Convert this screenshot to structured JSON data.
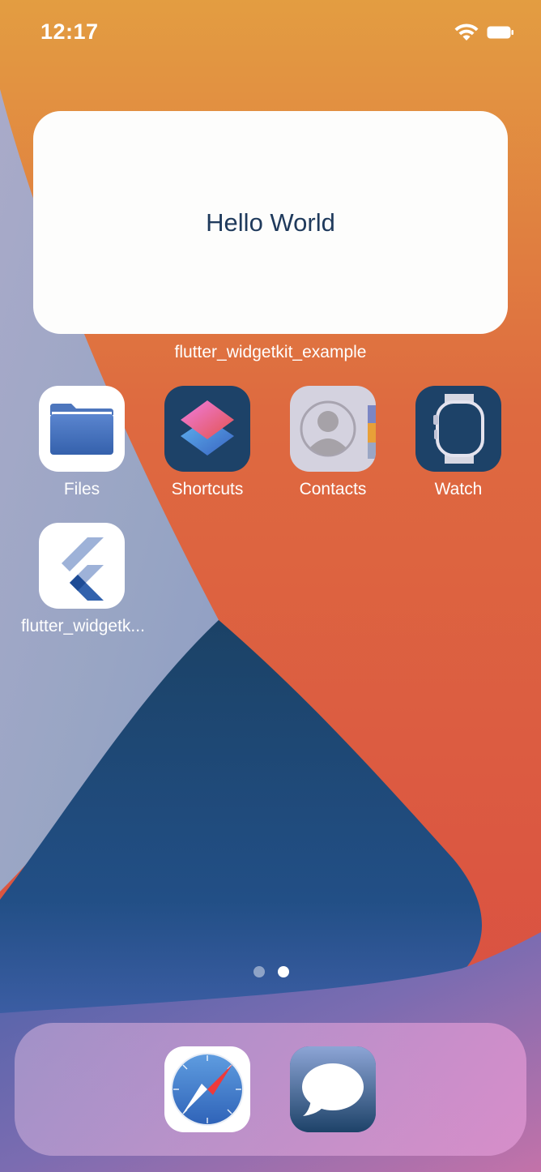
{
  "status_bar": {
    "time": "12:17",
    "wifi_icon": "wifi-icon",
    "battery_icon": "battery-icon"
  },
  "widget": {
    "text": "Hello World",
    "label": "flutter_widgetkit_example"
  },
  "apps": [
    {
      "label": "Files",
      "icon": "files-folder-icon"
    },
    {
      "label": "Shortcuts",
      "icon": "shortcuts-icon"
    },
    {
      "label": "Contacts",
      "icon": "contacts-icon"
    },
    {
      "label": "Watch",
      "icon": "watch-icon"
    },
    {
      "label": "flutter_widgetk...",
      "icon": "flutter-icon"
    }
  ],
  "page_indicator": {
    "pages": 2,
    "current": 2
  },
  "dock": [
    {
      "icon": "safari-compass-icon"
    },
    {
      "icon": "messages-bubble-icon"
    }
  ],
  "colors": {
    "wallpaper_orange": "#E39D41",
    "wallpaper_red": "#D94A42",
    "wallpaper_navy": "#1B4266",
    "wallpaper_lavender": "#9AA6C6",
    "widget_text": "#1F3A5C"
  }
}
